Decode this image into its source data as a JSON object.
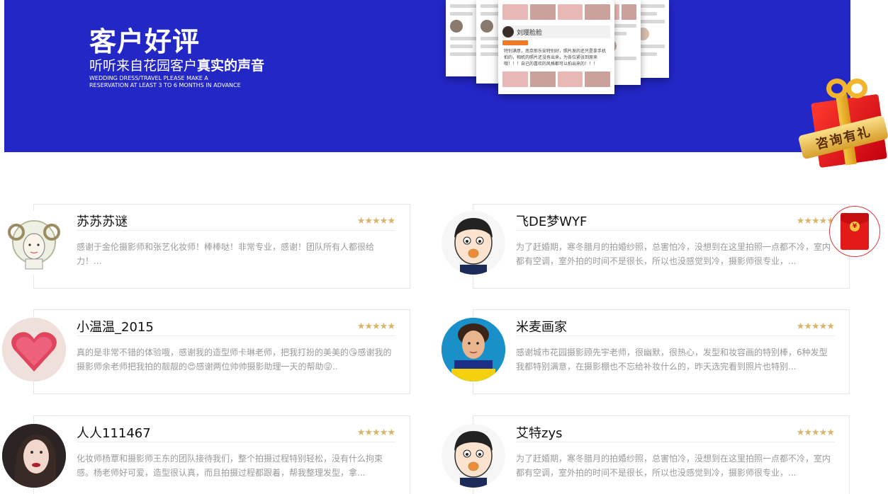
{
  "banner": {
    "title": "客户好评",
    "subtitle_plain": "听听来自花园客户",
    "subtitle_bold": "真实的声音",
    "en_line1": "WEDDING DRESS/TRAVEL PLEASE MAKE A",
    "en_line2": "RESERVATION AT LEAST 3 TO 6 MONTHS IN ADVANCE",
    "mockup_name": "刘璎脸脸",
    "mockup_text": "特别满意，南京郎乐安特别好，照片发的还只是拿手机拍的，相机的照片还没有出来，为各位紧张到原来哦！！！自己的喜欢的风格都可以拍出来的！！！"
  },
  "gift": {
    "label": "咨询有礼"
  },
  "red_packet": {
    "symbol": "¥"
  },
  "reviews": [
    {
      "name": "苏苏苏谜",
      "stars": "★★★★★",
      "text": "感谢于金伦摄影师和张艺化妆师！棒棒哒！非常专业，感谢！团队所有人都很给力！..."
    },
    {
      "name": "飞DE梦WYF",
      "stars": "★★★★★",
      "text": "为了赶婚期，寒冬腊月的拍婚纱照，总害怕冷，没想到在这里拍照一点都不冷，室内都有空调，室外拍的时间不是很长，所以也没感觉到冷，摄影师很专业，..."
    },
    {
      "name": "小温温_2015",
      "stars": "★★★★★",
      "text": "真的是非常不错的体验哦，感谢我的造型师卡琳老师，把我打扮的美美的😘感谢我的摄影师余老师把我拍的靓靓的😍感谢两位帅帅摄影助理一天的帮助😜.."
    },
    {
      "name": "米麦画家",
      "stars": "★★★★★",
      "text": "感谢城市花园摄影顾先宇老师，很幽默，很热心，发型和妆容画的特别棒，6种发型我都特别满意，在摄影棚也不忘给补妆什么的，昨天选完看到照片也特别..."
    },
    {
      "name": "人人111467",
      "stars": "★★★★★",
      "text": "化妆师杨覃和摄影师王东的团队接待我们，整个拍摄过程特别轻松，没有什么拘束感。杨老师好可爱，造型很认真，而且拍摄过程都跟着，帮我整理发型，拿..."
    },
    {
      "name": "艾特zys",
      "stars": "★★★★★",
      "text": "为了赶婚期，寒冬腊月的拍婚纱照，总害怕冷，没想到在这里拍照一点都不冷，室内都有空调，室外拍的时间不是很长，所以也没感觉到冷，摄影师很专业，..."
    }
  ]
}
